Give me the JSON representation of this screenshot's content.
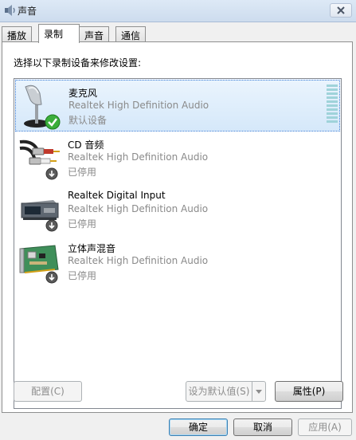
{
  "window": {
    "title": "声音",
    "icon": "speaker-icon"
  },
  "tabs": [
    {
      "label": "播放",
      "active": false
    },
    {
      "label": "录制",
      "active": true
    },
    {
      "label": "声音",
      "active": false
    },
    {
      "label": "通信",
      "active": false
    }
  ],
  "recording": {
    "prompt": "选择以下录制设备来修改设置:",
    "devices": [
      {
        "name": "麦克风",
        "driver": "Realtek High Definition Audio",
        "status": "默认设备",
        "icon": "microphone-icon",
        "badge": "default-check-icon",
        "selected": true
      },
      {
        "name": "CD 音频",
        "driver": "Realtek High Definition Audio",
        "status": "已停用",
        "icon": "cd-audio-cable-icon",
        "badge": "disabled-arrow-icon",
        "selected": false
      },
      {
        "name": "Realtek Digital Input",
        "driver": "Realtek High Definition Audio",
        "status": "已停用",
        "icon": "digital-input-icon",
        "badge": "disabled-arrow-icon",
        "selected": false
      },
      {
        "name": "立体声混音",
        "driver": "Realtek High Definition Audio",
        "status": "已停用",
        "icon": "sound-card-icon",
        "badge": "disabled-arrow-icon",
        "selected": false
      }
    ],
    "buttons": {
      "configure": "配置(C)",
      "set_default": "设为默认值(S)",
      "properties": "属性(P)"
    }
  },
  "footer": {
    "ok": "确定",
    "cancel": "取消",
    "apply": "应用(A)"
  },
  "colors": {
    "selection": "#d5e8fa",
    "level_meter": "#9fd3da",
    "default_check": "#3bae3b"
  }
}
